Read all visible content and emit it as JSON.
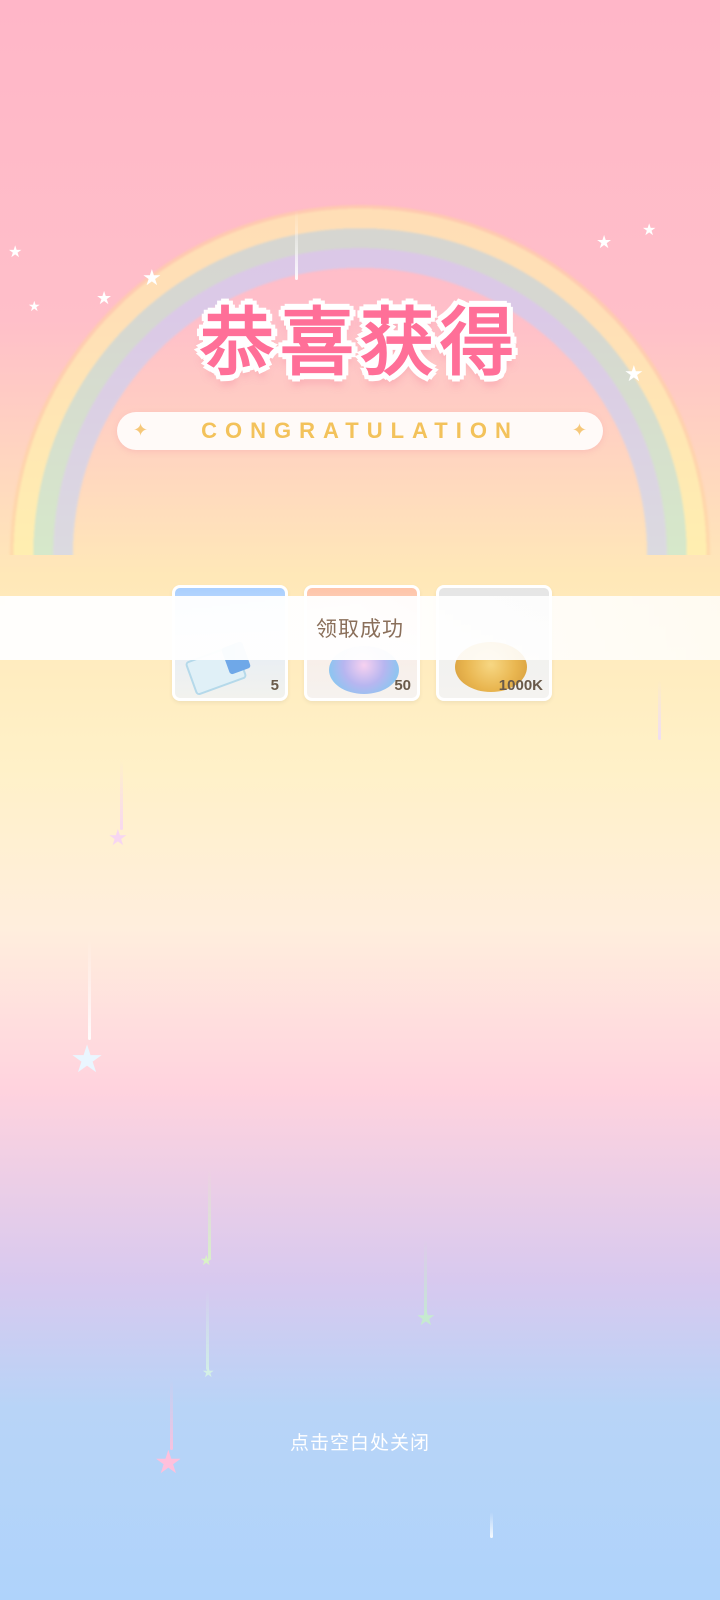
{
  "popup": {
    "title": "恭喜获得",
    "subtitle": "CONGRATULATION",
    "rewards": [
      {
        "name": "ticket",
        "qty": "5"
      },
      {
        "name": "gem",
        "qty": "50"
      },
      {
        "name": "coin",
        "qty": "1000K"
      }
    ],
    "toast": "领取成功",
    "close_hint": "点击空白处关闭"
  },
  "icons": {
    "reward_1": "ticket-icon",
    "reward_2": "gem-icon",
    "reward_3": "coin-icon",
    "decor": "star-icon"
  },
  "colors": {
    "title": "#ff6f98",
    "subtitle": "#f3c25b",
    "toast_text": "#8a6f5a"
  }
}
